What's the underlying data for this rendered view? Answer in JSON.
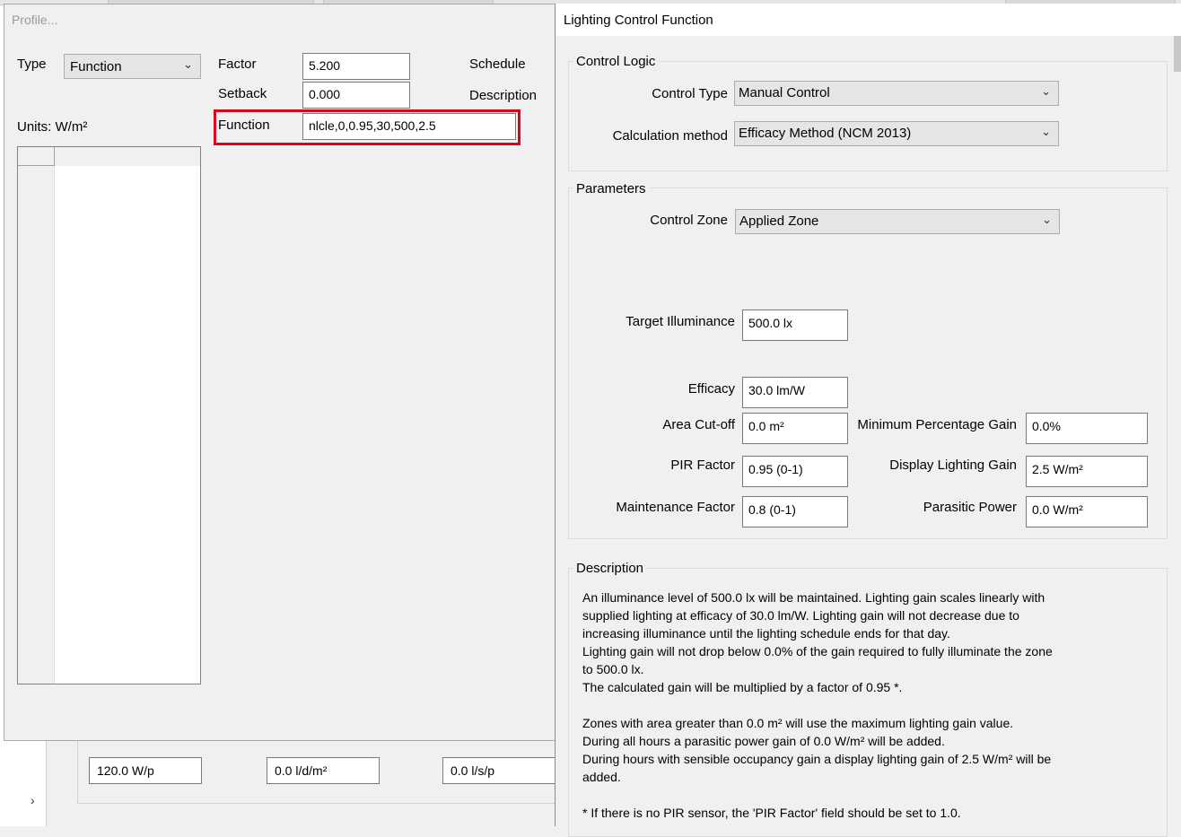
{
  "profile": {
    "title": "Profile...",
    "type_label": "Type",
    "type_value": "Function",
    "units_label": "Units: W/m²",
    "factor_label": "Factor",
    "factor_value": "5.200",
    "setback_label": "Setback",
    "setback_value": "0.000",
    "function_label": "Function",
    "function_value": "nlcle,0,0.95,30,500,2.5",
    "schedule_label": "Schedule",
    "description_label": "Description"
  },
  "background": {
    "fields": [
      "120.0 W/p",
      "0.0 l/d/m²",
      "0.0 l/s/p"
    ]
  },
  "lcf": {
    "title": "Lighting Control Function",
    "control_logic": {
      "title": "Control Logic",
      "control_type_label": "Control Type",
      "control_type_value": "Manual Control",
      "calc_method_label": "Calculation method",
      "calc_method_value": "Efficacy Method (NCM 2013)"
    },
    "parameters": {
      "title": "Parameters",
      "control_zone_label": "Control Zone",
      "control_zone_value": "Applied Zone",
      "target_illuminance_label": "Target Illuminance",
      "target_illuminance_value": "500.0 lx",
      "efficacy_label": "Efficacy",
      "efficacy_value": "30.0 lm/W",
      "area_cutoff_label": "Area Cut-off",
      "area_cutoff_value": "0.0 m²",
      "min_pct_gain_label": "Minimum Percentage Gain",
      "min_pct_gain_value": "0.0%",
      "pir_factor_label": "PIR Factor",
      "pir_factor_value": "0.95 (0-1)",
      "display_gain_label": "Display Lighting Gain",
      "display_gain_value": "2.5 W/m²",
      "maintenance_label": "Maintenance Factor",
      "maintenance_value": "0.8 (0-1)",
      "parasitic_label": "Parasitic Power",
      "parasitic_value": "0.0 W/m²"
    },
    "description": {
      "title": "Description",
      "lines": [
        "An illuminance level of 500.0 lx will be maintained. Lighting gain scales linearly with",
        "supplied lighting at efficacy of 30.0 lm/W. Lighting gain will not decrease due to",
        "increasing illuminance until the lighting schedule ends for that day.",
        "Lighting gain will not drop below 0.0% of the gain required to fully illuminate the zone",
        "to 500.0 lx.",
        "The calculated gain will be multiplied by a factor of 0.95 *.",
        "",
        "Zones with area greater than 0.0 m² will use the maximum lighting gain value.",
        "During all hours a parasitic power gain of 0.0 W/m² will be added.",
        "During hours with sensible occupancy gain a display lighting gain of 2.5 W/m² will be",
        "added.",
        "",
        "* If there is no PIR sensor, the 'PIR Factor' field should be set to 1.0."
      ]
    }
  },
  "icons": {
    "chevron_down": "⌄",
    "chevron_right": "›"
  }
}
